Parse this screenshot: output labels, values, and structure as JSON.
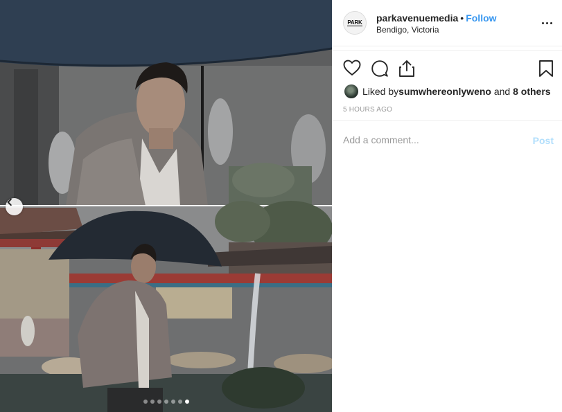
{
  "post": {
    "photo_alt": "",
    "carousel": {
      "total": 7,
      "active_index": 6
    }
  },
  "header": {
    "avatar_text": "PARK",
    "username": "parkavenuemedia",
    "separator": "•",
    "follow_label": "Follow",
    "location": "Bendigo, Victoria"
  },
  "likes": {
    "prefix": "Liked by ",
    "user": "sumwhereonlyweno",
    "middle": " and ",
    "others": "8 others"
  },
  "timestamp": "5 HOURS AGO",
  "comment": {
    "placeholder": "Add a comment...",
    "post_label": "Post"
  },
  "colors": {
    "accent": "#3897f0",
    "post_disabled": "#b2dffc",
    "muted": "#999999"
  },
  "icons": [
    "chevron-left-icon",
    "more-icon",
    "heart-icon",
    "comment-icon",
    "share-icon",
    "bookmark-icon"
  ]
}
